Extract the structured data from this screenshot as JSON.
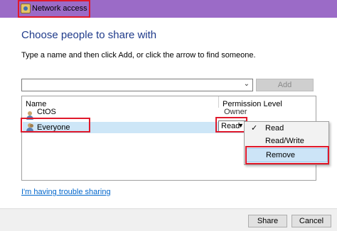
{
  "window": {
    "title": "Network access",
    "colors": {
      "title_bar": "#9b6bc7",
      "highlight": "#e0192b",
      "selection": "#cde6f7"
    }
  },
  "heading": "Choose people to share with",
  "instructions": "Type a name and then click Add, or click the arrow to find someone.",
  "name_input": {
    "value": "",
    "placeholder": ""
  },
  "add_label": "Add",
  "list": {
    "columns": [
      "Name",
      "Permission Level"
    ],
    "rows": [
      {
        "name": "CtOS",
        "permission": "Owner",
        "icon": "user-icon"
      },
      {
        "name": "Everyone",
        "permission": "Read",
        "icon": "group-icon",
        "selected": true
      }
    ]
  },
  "permission_menu": {
    "items": [
      {
        "label": "Read",
        "checked": true
      },
      {
        "label": "Read/Write",
        "checked": false
      },
      {
        "label": "Remove",
        "checked": false,
        "hovered": true
      }
    ],
    "check_glyph": "✓"
  },
  "trouble_link": "I'm having trouble sharing",
  "footer": {
    "share_label": "Share",
    "cancel_label": "Cancel"
  }
}
